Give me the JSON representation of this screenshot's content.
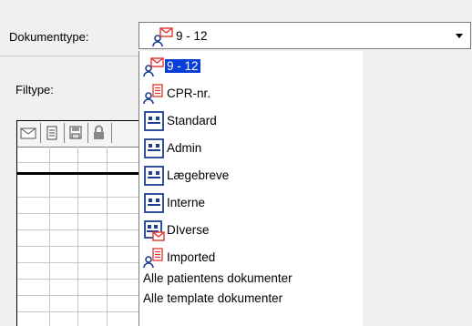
{
  "labels": {
    "dokumenttype": "Dokumenttype:",
    "filtype": "Filtype:"
  },
  "combo": {
    "selected_icon": "patient-letter-icon",
    "selected_value": "9 - 12"
  },
  "options": [
    {
      "label": "9 - 12",
      "icon": "patient-letter-icon",
      "selected": true
    },
    {
      "label": "CPR-nr.",
      "icon": "patient-list-icon",
      "selected": false
    },
    {
      "label": "Standard",
      "icon": "template-icon",
      "selected": false
    },
    {
      "label": "Admin",
      "icon": "template-icon",
      "selected": false
    },
    {
      "label": "Lægebreve",
      "icon": "template-icon",
      "selected": false
    },
    {
      "label": "Interne",
      "icon": "template-icon",
      "selected": false
    },
    {
      "label": "DIverse",
      "icon": "template-letter-icon",
      "selected": false
    },
    {
      "label": "Imported",
      "icon": "patient-list-icon",
      "selected": false
    },
    {
      "label": "Alle patientens dokumenter",
      "icon": "",
      "selected": false
    },
    {
      "label": "Alle template dokumenter",
      "icon": "",
      "selected": false
    }
  ],
  "table_header_icons": [
    "envelope-icon",
    "document-icon",
    "save-icon",
    "lock-icon"
  ],
  "colors": {
    "selection": "#0a3ed8",
    "icon_red": "#e0332b",
    "icon_blue": "#1c3f8f"
  }
}
